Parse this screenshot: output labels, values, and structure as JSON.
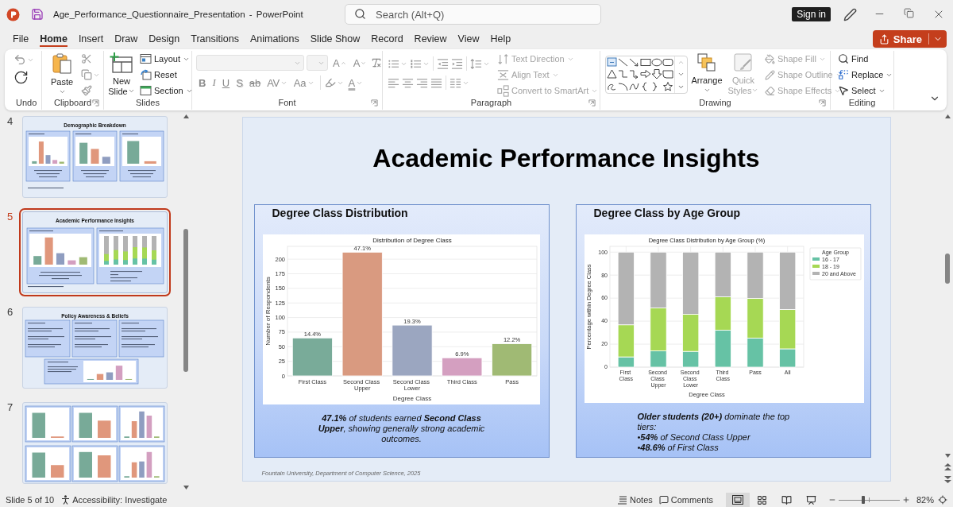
{
  "window": {
    "title": "Age_Performance_Questionnaire_Presentation - PowerPoint",
    "sign_in": "Sign in"
  },
  "search": {
    "placeholder": "Search (Alt+Q)"
  },
  "menu_tabs": [
    {
      "label": "File",
      "selected": false
    },
    {
      "label": "Home",
      "selected": true
    },
    {
      "label": "Insert",
      "selected": false
    },
    {
      "label": "Draw",
      "selected": false
    },
    {
      "label": "Design",
      "selected": false
    },
    {
      "label": "Transitions",
      "selected": false
    },
    {
      "label": "Animations",
      "selected": false
    },
    {
      "label": "Slide Show",
      "selected": false
    },
    {
      "label": "Record",
      "selected": false
    },
    {
      "label": "Review",
      "selected": false
    },
    {
      "label": "View",
      "selected": false
    },
    {
      "label": "Help",
      "selected": false
    }
  ],
  "share_button": "Share",
  "ribbon": {
    "undo": {
      "label": "Undo"
    },
    "clipboard": {
      "label": "Clipboard",
      "paste": "Paste"
    },
    "slides": {
      "label": "Slides",
      "new_slide": "New Slide",
      "items": [
        {
          "label": "Layout",
          "dropdown": true,
          "disabled": false
        },
        {
          "label": "Reset",
          "dropdown": false,
          "disabled": false
        },
        {
          "label": "Section",
          "dropdown": true,
          "disabled": false
        }
      ]
    },
    "font": {
      "label": "Font",
      "disabled": true,
      "grow": "A",
      "shrink": "A",
      "format_buttons": [
        {
          "label": "B",
          "kind": "bold",
          "dropdown": false
        },
        {
          "label": "I",
          "kind": "italic",
          "dropdown": false
        },
        {
          "label": "U",
          "kind": "underline",
          "dropdown": false
        },
        {
          "label": "S",
          "kind": "shadow",
          "dropdown": false
        },
        {
          "label": "ab",
          "kind": "strikethrough",
          "dropdown": false
        },
        {
          "label": "AV",
          "kind": "spacing",
          "dropdown": true
        },
        {
          "label": "Aa",
          "kind": "case",
          "dropdown": true
        }
      ],
      "font_color": "A"
    },
    "paragraph": {
      "label": "Paragraph",
      "disabled": true,
      "items": [
        {
          "label": "Text Direction",
          "dropdown": true,
          "disabled": true
        },
        {
          "label": "Align Text",
          "dropdown": true,
          "disabled": true
        },
        {
          "label": "Convert to SmartArt",
          "dropdown": true,
          "disabled": true
        }
      ]
    },
    "drawing": {
      "label": "Drawing",
      "arrange": {
        "label": "Arrange",
        "disabled": false
      },
      "quick_styles": {
        "label": "Quick Styles",
        "disabled": true
      },
      "items": [
        {
          "label": "Shape Fill",
          "dropdown": true,
          "disabled": true
        },
        {
          "label": "Shape Outline",
          "dropdown": true,
          "disabled": true
        },
        {
          "label": "Shape Effects",
          "dropdown": true,
          "disabled": true
        }
      ]
    },
    "editing": {
      "label": "Editing",
      "items": [
        {
          "label": "Find",
          "dropdown": false,
          "disabled": false
        },
        {
          "label": "Replace",
          "dropdown": true,
          "disabled": false
        },
        {
          "label": "Select",
          "dropdown": true,
          "disabled": false
        }
      ]
    }
  },
  "slides": [
    {
      "number": "4",
      "title": "Demographic Breakdown",
      "kind": "three_charts",
      "selected": false
    },
    {
      "number": "5",
      "title": "Academic Performance Insights",
      "kind": "two_charts",
      "selected": true
    },
    {
      "number": "6",
      "title": "Policy Awareness & Beliefs",
      "kind": "insights",
      "selected": false
    },
    {
      "number": "7",
      "kind": "chart_grid",
      "selected": false
    }
  ],
  "slide": {
    "title": "Academic Performance Insights",
    "cards": [
      {
        "kind": "summary",
        "heading": "Degree Class Distribution",
        "chart_data": {
          "type": "bar",
          "title": "Distribution of Degree Class",
          "xlabel": "Degree Class",
          "ylabel": "Number of Respondents",
          "categories": [
            "First Class",
            "Second Class Upper",
            "Second Class Lower",
            "Third Class",
            "Pass"
          ],
          "values": [
            65,
            212,
            87,
            31,
            55
          ],
          "colors": [
            "#79ab99",
            "#d99a80",
            "#9ba6c0",
            "#d49fc0",
            "#a0ba74"
          ],
          "annotations": [
            "14.4%",
            "47.1%",
            "19.3%",
            "6.9%",
            "12.2%"
          ],
          "yticks": [
            0,
            25,
            50,
            75,
            100,
            125,
            150,
            175,
            200
          ],
          "ylim": [
            0,
            222
          ],
          "grid": "y"
        },
        "caption": [
          "**47.1%** of students earned **Second Class Upper**, showing generally strong academic outcomes."
        ]
      },
      {
        "kind": "bullets",
        "heading": "Degree Class by Age Group",
        "chart_data": {
          "type": "bar",
          "stacked": true,
          "title": "Degree Class Distribution by Age Group (%)",
          "xlabel": "Degree Class",
          "ylabel": "Percentage within Degree Class",
          "legend_title": "Age Group",
          "legend": "right",
          "categories": [
            "First Class",
            "Second Class Upper",
            "Second Class Lower",
            "Third Class",
            "Pass",
            "All"
          ],
          "series": [
            {
              "name": "16 - 17",
              "color": "#66c2a5",
              "values": [
                8.9,
                14.1,
                13.7,
                32.1,
                25.3,
                15.9
              ]
            },
            {
              "name": "18 - 19",
              "color": "#a6d854",
              "values": [
                27.9,
                37.4,
                32.3,
                29.0,
                34.5,
                34.2
              ]
            },
            {
              "name": "20 and Above",
              "color": "#b3b3b3",
              "values": [
                63.2,
                48.5,
                54.0,
                38.9,
                40.2,
                49.9
              ]
            }
          ],
          "yticks": [
            0,
            20,
            40,
            60,
            80,
            100
          ],
          "ylim": [
            0,
            105
          ],
          "grid": "both"
        },
        "caption": [
          "**Older students (20+)** dominate the top tiers:",
          "•**54%** of Second Class Upper",
          "•**48.6%** of First Class"
        ]
      }
    ],
    "footer": "Fountain University, Department of Computer Science, 2025"
  },
  "status_bar": {
    "slide_info": "Slide 5 of 10",
    "accessibility": "Accessibility: Investigate",
    "notes": "Notes",
    "comments": "Comments",
    "views": [
      {
        "selected": true
      },
      {
        "selected": false
      },
      {
        "selected": false
      },
      {
        "selected": false
      }
    ],
    "zoom": {
      "level": 0.4,
      "reading": "82%"
    }
  }
}
